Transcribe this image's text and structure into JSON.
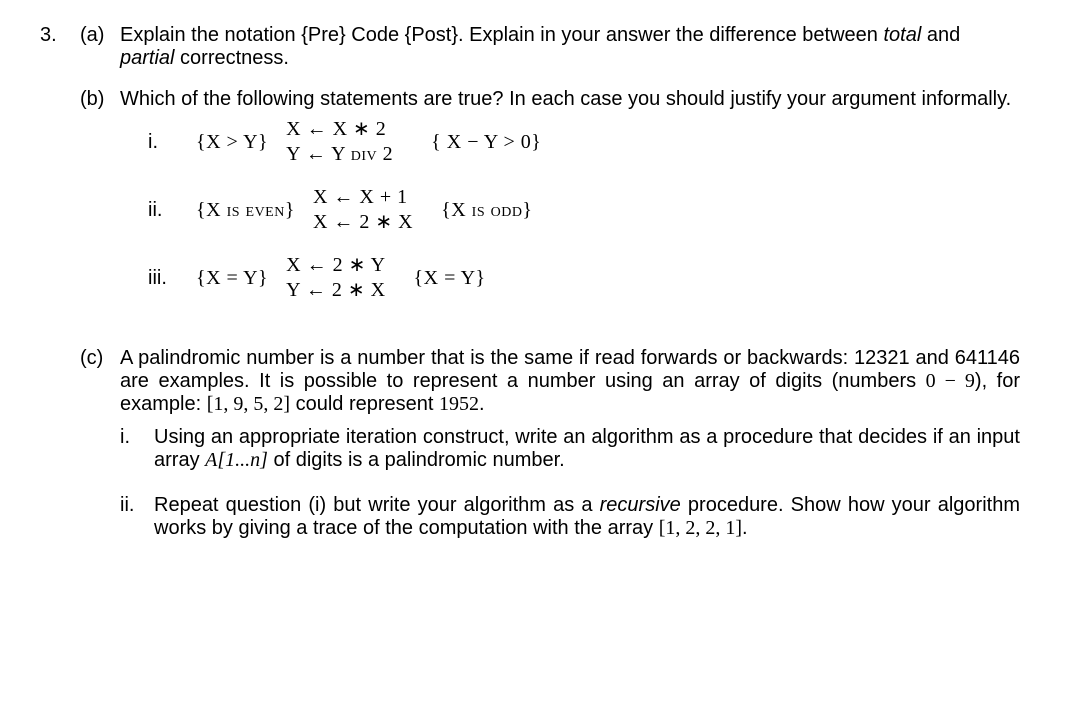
{
  "q_number": "3.",
  "parts": {
    "a": {
      "label": "(a)",
      "text_1": "Explain the notation  {Pre} Code {Post}. Explain in your answer the difference between ",
      "total": "total",
      "and": " and ",
      "partial": "partial",
      "text_2": " correctness."
    },
    "b": {
      "label": "(b)",
      "intro": "Which of the following statements are true? In each case you should justify your argument informally.",
      "items": [
        {
          "roman": "i.",
          "pre": "{X > Y}",
          "code1": "X ← X ∗ 2",
          "code2": "Y ← Y div 2",
          "post": "{ X − Y > 0}"
        },
        {
          "roman": "ii.",
          "pre": "{X is even}",
          "code1": "X ← X + 1",
          "code2": "X ← 2 ∗ X",
          "post": "{X is odd}"
        },
        {
          "roman": "iii.",
          "pre": "{X = Y}",
          "code1": "X ← 2 ∗ Y",
          "code2": "Y ← 2 ∗ X",
          "post": "{X = Y}"
        }
      ]
    },
    "c": {
      "label": "(c)",
      "intro_1": "A palindromic number is a number that is the same if read forwards or backwards: 12321 and 641146 are examples.  It is possible to represent a number using an array of digits (numbers ",
      "range": "0 − 9",
      "intro_2": "), for example: ",
      "array_ex": "[1, 9, 5, 2]",
      "intro_3": " could represent ",
      "num_ex": "1952",
      "intro_4": ".",
      "i": {
        "roman": "i.",
        "text_1": "Using an appropriate iteration construct, write an algorithm as a procedure that decides if an input array ",
        "arr": "A[1...n]",
        "text_2": " of digits is a palindromic number."
      },
      "ii": {
        "roman": "ii.",
        "text_1": "Repeat question (i) but write your algorithm as a ",
        "recursive": "recursive",
        "text_2": " procedure. Show how your algorithm works by giving a trace of the computation with the array ",
        "arr": "[1, 2, 2, 1]",
        "text_3": "."
      }
    }
  }
}
